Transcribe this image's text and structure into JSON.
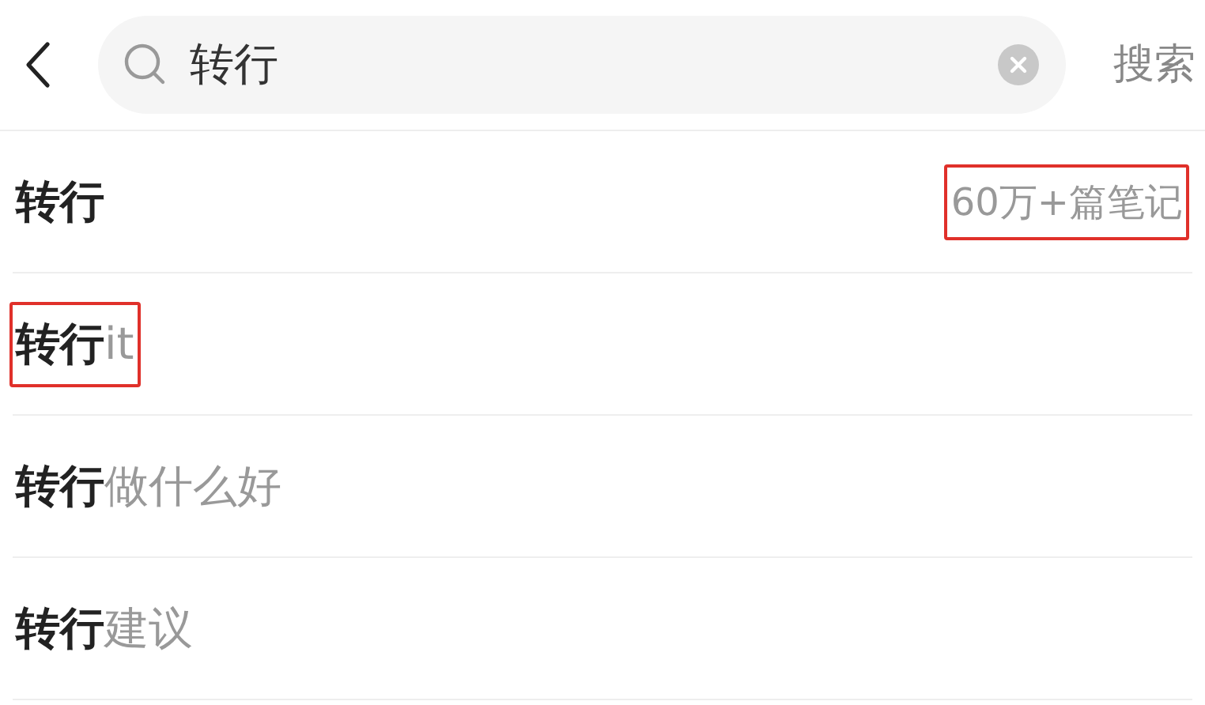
{
  "search": {
    "value": "转行",
    "button": "搜索"
  },
  "suggestions": [
    {
      "match": "转行",
      "count": {
        "text": "60万+篇笔记",
        "annotated": true
      },
      "annotated": false
    },
    {
      "match": "转行",
      "rest": "it",
      "annotated": true
    },
    {
      "match": "转行",
      "rest": "做什么好",
      "annotated": false
    },
    {
      "match": "转行",
      "rest": "建议",
      "annotated": false
    }
  ]
}
